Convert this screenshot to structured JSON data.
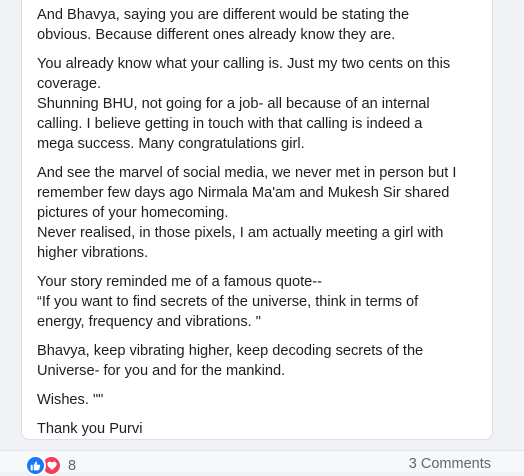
{
  "post": {
    "paragraphs": [
      [
        "And Bhavya, saying you are different would be stating the",
        "obvious. Because different ones already know they are."
      ],
      [
        "You already know what your calling is. Just my two cents on this",
        "coverage.",
        "Shunning BHU, not going for a job- all because of an internal",
        "calling. I believe getting in touch with that calling is indeed a",
        "mega success. Many congratulations girl."
      ],
      [
        "And see the marvel of social media, we never met in person but I",
        "remember few days ago Nirmala Ma'am and Mukesh Sir shared",
        "pictures of your homecoming.",
        "Never realised, in those pixels, I am actually meeting a girl with",
        "higher vibrations."
      ],
      [
        "Your story reminded me of a famous quote--",
        "“If you want to find secrets of the universe, think in terms of",
        "energy, frequency and vibrations. \""
      ],
      [
        "Bhavya, keep vibrating higher, keep decoding secrets of the",
        "Universe- for you and for the mankind."
      ],
      [
        "Wishes. \"\""
      ],
      [
        "Thank you Purvi"
      ]
    ]
  },
  "footer": {
    "reaction_count": "8",
    "reaction_icons": [
      "like-icon",
      "love-icon"
    ],
    "comments_label": "3 Comments"
  },
  "colors": {
    "like": "#1877f2",
    "love": "#f33e58",
    "text": "#1c1e21",
    "muted": "#65676b"
  }
}
